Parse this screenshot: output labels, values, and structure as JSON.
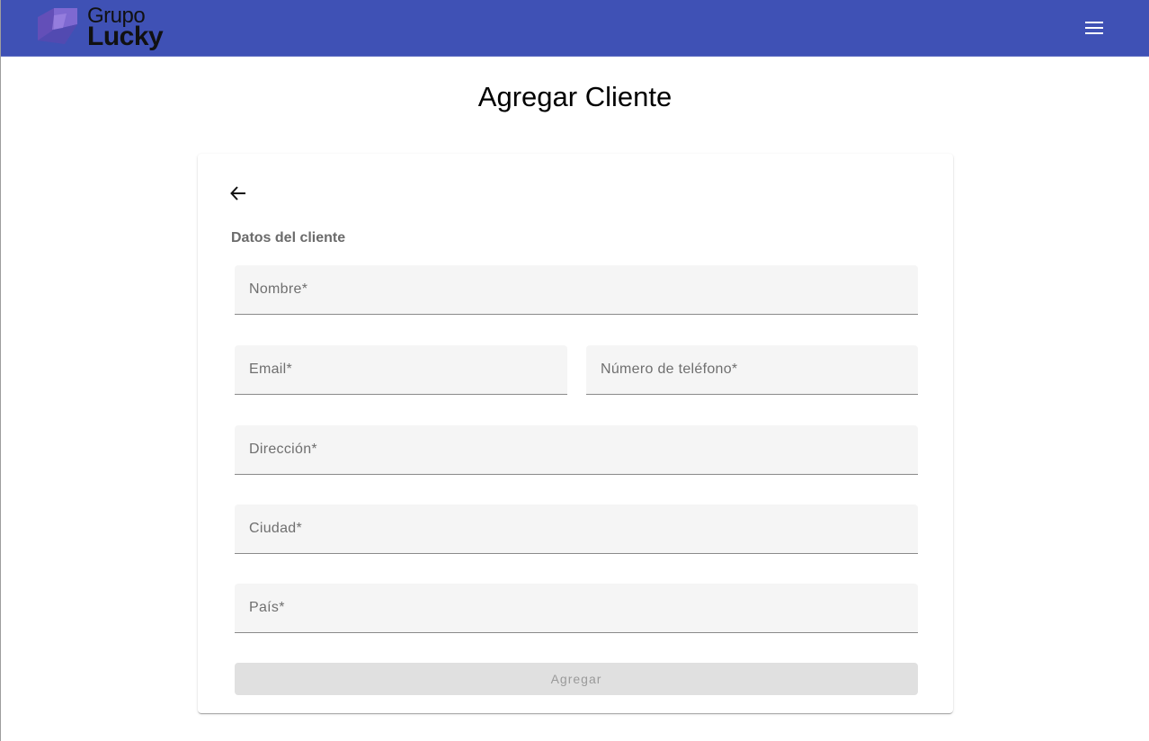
{
  "header": {
    "logo": {
      "line1": "Grupo",
      "line2": "Lucky"
    },
    "menu_icon": "menu-icon",
    "colors": {
      "toolbar": "#3f51b5",
      "logo_mark": "#7b5fc4"
    }
  },
  "page": {
    "title": "Agregar Cliente"
  },
  "form": {
    "back_icon": "arrow-left-icon",
    "section_label": "Datos del cliente",
    "fields": {
      "nombre": {
        "placeholder": "Nombre*",
        "value": ""
      },
      "email": {
        "placeholder": "Email*",
        "value": ""
      },
      "telefono": {
        "placeholder": "Número de teléfono*",
        "value": ""
      },
      "direccion": {
        "placeholder": "Dirección*",
        "value": ""
      },
      "ciudad": {
        "placeholder": "Ciudad*",
        "value": ""
      },
      "pais": {
        "placeholder": "País*",
        "value": ""
      }
    },
    "submit": {
      "label": "Agregar",
      "disabled": true
    }
  }
}
